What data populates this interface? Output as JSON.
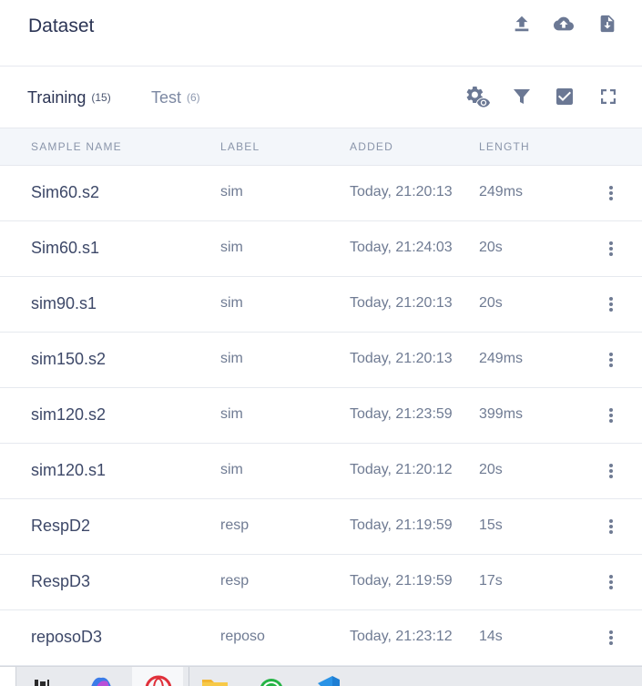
{
  "header": {
    "title": "Dataset",
    "icons": [
      "upload-icon",
      "cloud-upload-icon",
      "file-download-icon"
    ]
  },
  "tabs": [
    {
      "label": "Training",
      "count": "(15)",
      "active": true
    },
    {
      "label": "Test",
      "count": "(6)",
      "active": false
    }
  ],
  "toolbar_icons": [
    "settings-eye-icon",
    "filter-icon",
    "checkbox-icon",
    "fullscreen-icon"
  ],
  "table": {
    "columns": [
      "SAMPLE NAME",
      "LABEL",
      "ADDED",
      "LENGTH"
    ],
    "rows": [
      {
        "name": "Sim60.s2",
        "label": "sim",
        "added": "Today, 21:20:13",
        "length": "249ms"
      },
      {
        "name": "Sim60.s1",
        "label": "sim",
        "added": "Today, 21:24:03",
        "length": "20s"
      },
      {
        "name": "sim90.s1",
        "label": "sim",
        "added": "Today, 21:20:13",
        "length": "20s"
      },
      {
        "name": "sim150.s2",
        "label": "sim",
        "added": "Today, 21:20:13",
        "length": "249ms"
      },
      {
        "name": "sim120.s2",
        "label": "sim",
        "added": "Today, 21:23:59",
        "length": "399ms"
      },
      {
        "name": "sim120.s1",
        "label": "sim",
        "added": "Today, 21:20:12",
        "length": "20s"
      },
      {
        "name": "RespD2",
        "label": "resp",
        "added": "Today, 21:19:59",
        "length": "15s"
      },
      {
        "name": "RespD3",
        "label": "resp",
        "added": "Today, 21:19:59",
        "length": "17s"
      },
      {
        "name": "reposoD3",
        "label": "reposo",
        "added": "Today, 21:23:12",
        "length": "14s"
      }
    ]
  },
  "taskbar": {
    "apps": [
      "taskview-icon",
      "copilot-icon",
      "opera-icon",
      "file-explorer-icon",
      "whatsapp-icon",
      "vscode-icon"
    ]
  },
  "colors": {
    "text_primary": "#2b3454",
    "text_secondary": "#6f7b93",
    "icon": "#6b7894",
    "header_bg": "#f3f6fa",
    "border": "#e6e9ef"
  }
}
